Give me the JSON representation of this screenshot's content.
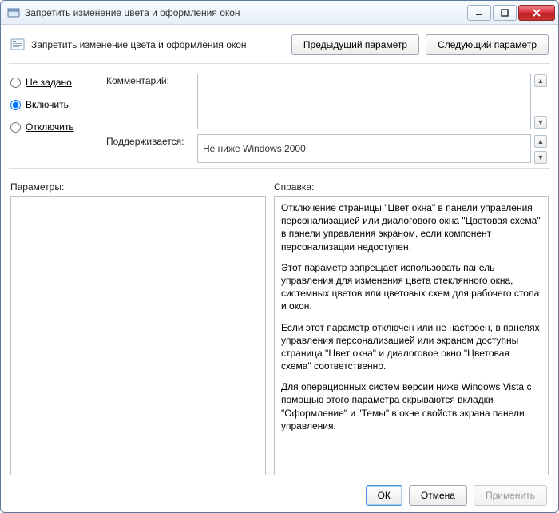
{
  "window": {
    "title": "Запретить изменение цвета и оформления окон"
  },
  "header": {
    "policy_title": "Запретить изменение цвета и оформления окон",
    "prev_button": "Предыдущий параметр",
    "next_button": "Следующий параметр"
  },
  "state": {
    "not_configured_label": "Не задано",
    "enabled_label": "Включить",
    "disabled_label": "Отключить",
    "selected": "enabled"
  },
  "fields": {
    "comment_label": "Комментарий:",
    "comment_value": "",
    "supported_label": "Поддерживается:",
    "supported_value": "Не ниже Windows 2000"
  },
  "panels": {
    "params_label": "Параметры:",
    "params_content": "",
    "help_label": "Справка:",
    "help_paragraphs": [
      "Отключение страницы \"Цвет окна\" в панели управления персонализацией или диалогового окна \"Цветовая схема\" в панели управления экраном, если компонент персонализации недоступен.",
      "Этот параметр запрещает использовать панель управления для изменения цвета стеклянного окна, системных цветов или цветовых схем для рабочего стола и окон.",
      "Если этот параметр отключен или не настроен, в панелях управления персонализацией или экраном доступны страница \"Цвет окна\" и диалоговое окно \"Цветовая схема\" соответственно.",
      "Для операционных систем версии ниже Windows Vista с помощью этого параметра скрываются вкладки \"Оформление\" и \"Темы\" в окне свойств экрана панели управления."
    ]
  },
  "footer": {
    "ok": "ОК",
    "cancel": "Отмена",
    "apply": "Применить"
  }
}
